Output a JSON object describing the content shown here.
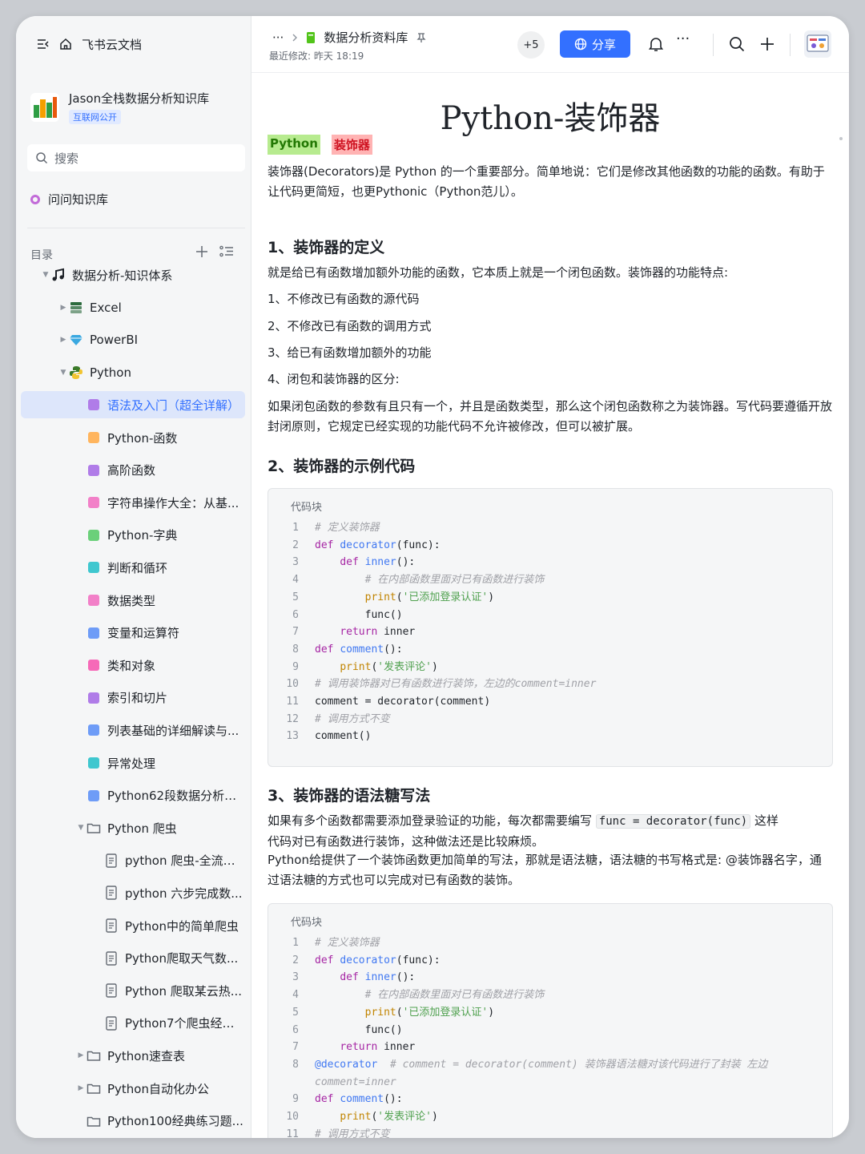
{
  "app": {
    "name": "飞书云文档"
  },
  "space": {
    "name": "Jason全栈数据分析知识库",
    "badge": "互联网公开"
  },
  "search": {
    "label": "搜索"
  },
  "ask": {
    "label": "问问知识库"
  },
  "toc": {
    "label": "目录"
  },
  "tree": [
    {
      "label": "数据分析-知识体系",
      "level": 0,
      "caret": "down",
      "icon": "music-note-icon",
      "color": "#1f2329"
    },
    {
      "label": "Excel",
      "level": 1,
      "caret": "right",
      "icon": "stack-icon",
      "color": "#2d6b3e"
    },
    {
      "label": "PowerBI",
      "level": 1,
      "caret": "right",
      "icon": "diamond-icon",
      "color": "#3aa8e0"
    },
    {
      "label": "Python",
      "level": 1,
      "caret": "down",
      "icon": "python-icon",
      "color": "#3b7a2a"
    },
    {
      "label": "语法及入门（超全详解）",
      "level": 2,
      "icon": "doc-icon",
      "color": "#b07ce8",
      "active": true
    },
    {
      "label": "Python-函数",
      "level": 2,
      "icon": "doc-icon",
      "color": "#ffb55e"
    },
    {
      "label": "高阶函数",
      "level": 2,
      "icon": "doc-icon",
      "color": "#b07ce8"
    },
    {
      "label": "字符串操作大全：从基...",
      "level": 2,
      "icon": "doc-icon",
      "color": "#f280c8"
    },
    {
      "label": "Python-字典",
      "level": 2,
      "icon": "doc-icon",
      "color": "#6bd07a"
    },
    {
      "label": "判断和循环",
      "level": 2,
      "icon": "doc-icon",
      "color": "#3fc7cf"
    },
    {
      "label": "数据类型",
      "level": 2,
      "icon": "doc-icon",
      "color": "#f280c8"
    },
    {
      "label": "变量和运算符",
      "level": 2,
      "icon": "doc-icon",
      "color": "#6e9cf7"
    },
    {
      "label": "类和对象",
      "level": 2,
      "icon": "doc-icon",
      "color": "#f66ab8"
    },
    {
      "label": "索引和切片",
      "level": 2,
      "icon": "doc-icon",
      "color": "#b07ce8"
    },
    {
      "label": "列表基础的详细解读与...",
      "level": 2,
      "icon": "doc-icon",
      "color": "#6e9cf7"
    },
    {
      "label": "异常处理",
      "level": 2,
      "icon": "doc-icon",
      "color": "#3fc7cf"
    },
    {
      "label": "Python62段数据分析和...",
      "level": 2,
      "icon": "doc-icon",
      "color": "#6e9cf7"
    },
    {
      "label": "Python 爬虫",
      "level": 2,
      "caret": "down",
      "icon": "folder-icon",
      "color": "#646a73"
    },
    {
      "label": "python 爬虫-全流程...",
      "level": 3,
      "icon": "file-icon",
      "color": "#646a73"
    },
    {
      "label": "python 六步完成数...",
      "level": 3,
      "icon": "file-icon",
      "color": "#646a73"
    },
    {
      "label": "Python中的简单爬虫",
      "level": 3,
      "icon": "file-icon",
      "color": "#646a73"
    },
    {
      "label": "Python爬取天气数...",
      "level": 3,
      "icon": "file-icon",
      "color": "#646a73"
    },
    {
      "label": "Python 爬取某云热...",
      "level": 3,
      "icon": "file-icon",
      "color": "#646a73"
    },
    {
      "label": "Python7个爬虫经典...",
      "level": 3,
      "icon": "file-icon",
      "color": "#646a73"
    },
    {
      "label": "Python速查表",
      "level": 2,
      "caret": "right",
      "icon": "folder-icon",
      "color": "#646a73"
    },
    {
      "label": "Python自动化办公",
      "level": 2,
      "caret": "right",
      "icon": "folder-icon",
      "color": "#646a73"
    },
    {
      "label": "Python100经典练习题...",
      "level": 2,
      "icon": "folder-icon",
      "color": "#646a73"
    }
  ],
  "header": {
    "ellipsis": "···",
    "crumb": "数据分析资料库",
    "modified": "最近修改: 昨天 18:19",
    "collaborators": "+5",
    "share_label": "分享",
    "more": "···"
  },
  "doc": {
    "title": "Python-装饰器",
    "tags": [
      "Python",
      "装饰器"
    ],
    "intro": "装饰器(Decorators)是 Python 的一个重要部分。简单地说：它们是修改其他函数的功能的函数。有助于让代码更简短，也更Pythonic（Python范儿）。",
    "h1": "1、装饰器的定义",
    "def_text": "就是给已有函数增加额外功能的函数，它本质上就是一个闭包函数。装饰器的功能特点:",
    "points": [
      "1、不修改已有函数的源代码",
      "2、不修改已有函数的调用方式",
      "3、给已有函数增加额外的功能",
      "4、闭包和装饰器的区分:"
    ],
    "closure_text": "如果闭包函数的参数有且只有一个，并且是函数类型，那么这个闭包函数称之为装饰器。写代码要遵循开放封闭原则，它规定已经实现的功能代码不允许被修改，但可以被扩展。",
    "h2": "2、装饰器的示例代码",
    "code_label": "代码块",
    "code1": [
      {
        "n": "1",
        "t": "# 定义装饰器"
      },
      {
        "n": "2",
        "t": "def decorator(func):"
      },
      {
        "n": "3",
        "t": "    def inner():"
      },
      {
        "n": "4",
        "t": "        # 在内部函数里面对已有函数进行装饰"
      },
      {
        "n": "5",
        "t": "        print('已添加登录认证')"
      },
      {
        "n": "6",
        "t": "        func()"
      },
      {
        "n": "7",
        "t": "    return inner"
      },
      {
        "n": "8",
        "t": "def comment():"
      },
      {
        "n": "9",
        "t": "    print('发表评论')"
      },
      {
        "n": "10",
        "t": "# 调用装饰器对已有函数进行装饰，左边的comment=inner"
      },
      {
        "n": "11",
        "t": "comment = decorator(comment)"
      },
      {
        "n": "12",
        "t": "# 调用方式不变"
      },
      {
        "n": "13",
        "t": "comment()"
      }
    ],
    "h3": "3、装饰器的语法糖写法",
    "sugar_p1a": "如果有多个函数都需要添加登录验证的功能，每次都需要编写",
    "sugar_code": "func = decorator(func)",
    "sugar_p1b": "这样",
    "sugar_p1c": "代码对已有函数进行装饰，这种做法还是比较麻烦。",
    "sugar_p2": "Python给提供了一个装饰函数更加简单的写法，那就是语法糖，语法糖的书写格式是: @装饰器名字，通过语法糖的方式也可以完成对已有函数的装饰。",
    "code2": [
      {
        "n": "1",
        "t": "# 定义装饰器"
      },
      {
        "n": "2",
        "t": "def decorator(func):"
      },
      {
        "n": "3",
        "t": "    def inner():"
      },
      {
        "n": "4",
        "t": "        # 在内部函数里面对已有函数进行装饰"
      },
      {
        "n": "5",
        "t": "        print('已添加登录认证')"
      },
      {
        "n": "6",
        "t": "        func()"
      },
      {
        "n": "7",
        "t": "    return inner"
      },
      {
        "n": "8",
        "t": "@decorator  # comment = decorator(comment) 装饰器语法糖对该代码进行了封装 左边"
      },
      {
        "n": "",
        "t": "comment=inner"
      },
      {
        "n": "9",
        "t": "def comment():"
      },
      {
        "n": "10",
        "t": "    print('发表评论')"
      },
      {
        "n": "11",
        "t": "# 调用方式不变"
      }
    ]
  }
}
